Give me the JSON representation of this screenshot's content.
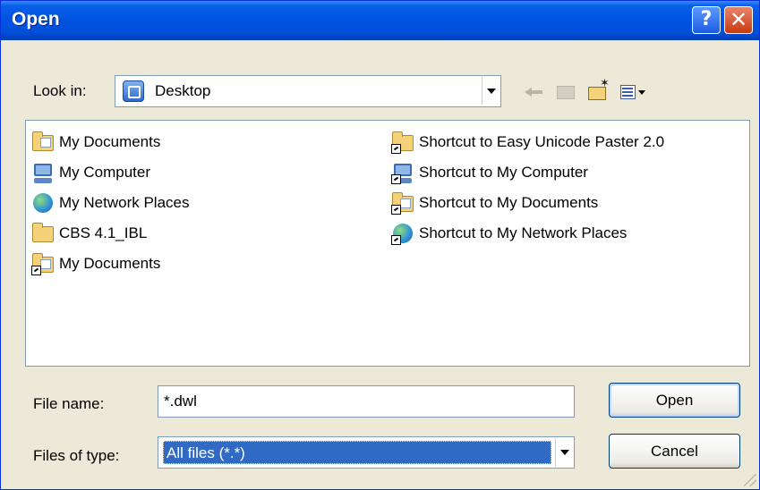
{
  "window": {
    "title": "Open",
    "help_label": "?",
    "close_label": "✕"
  },
  "look_in": {
    "label": "Look in:",
    "value": "Desktop",
    "icon": "desktop-icon"
  },
  "toolbar": {
    "icons": [
      "back-arrow-icon",
      "up-one-level-icon",
      "create-new-folder-icon",
      "view-menu-icon"
    ]
  },
  "file_list": {
    "columns": [
      [
        {
          "label": "My Documents",
          "icon": "my-documents-icon"
        },
        {
          "label": "My Computer",
          "icon": "my-computer-icon"
        },
        {
          "label": "My Network Places",
          "icon": "network-places-icon"
        },
        {
          "label": "CBS 4.1_IBL",
          "icon": "folder-icon"
        },
        {
          "label": "My Documents",
          "icon": "my-documents-shortcut-icon"
        }
      ],
      [
        {
          "label": "Shortcut to Easy Unicode Paster 2.0",
          "icon": "folder-shortcut-icon"
        },
        {
          "label": "Shortcut to My Computer",
          "icon": "computer-shortcut-icon"
        },
        {
          "label": "Shortcut to My Documents",
          "icon": "documents-shortcut-icon"
        },
        {
          "label": "Shortcut to My Network Places",
          "icon": "network-shortcut-icon"
        }
      ]
    ]
  },
  "file_name": {
    "label": "File name:",
    "value": "*.dwl"
  },
  "file_type": {
    "label": "Files of type:",
    "value": "All files (*.*)"
  },
  "buttons": {
    "open": "Open",
    "cancel": "Cancel"
  },
  "colors": {
    "titlebar": "#0054E3",
    "dialog_bg": "#ECE9D8",
    "selection": "#316AC5",
    "close": "#C73A10"
  }
}
